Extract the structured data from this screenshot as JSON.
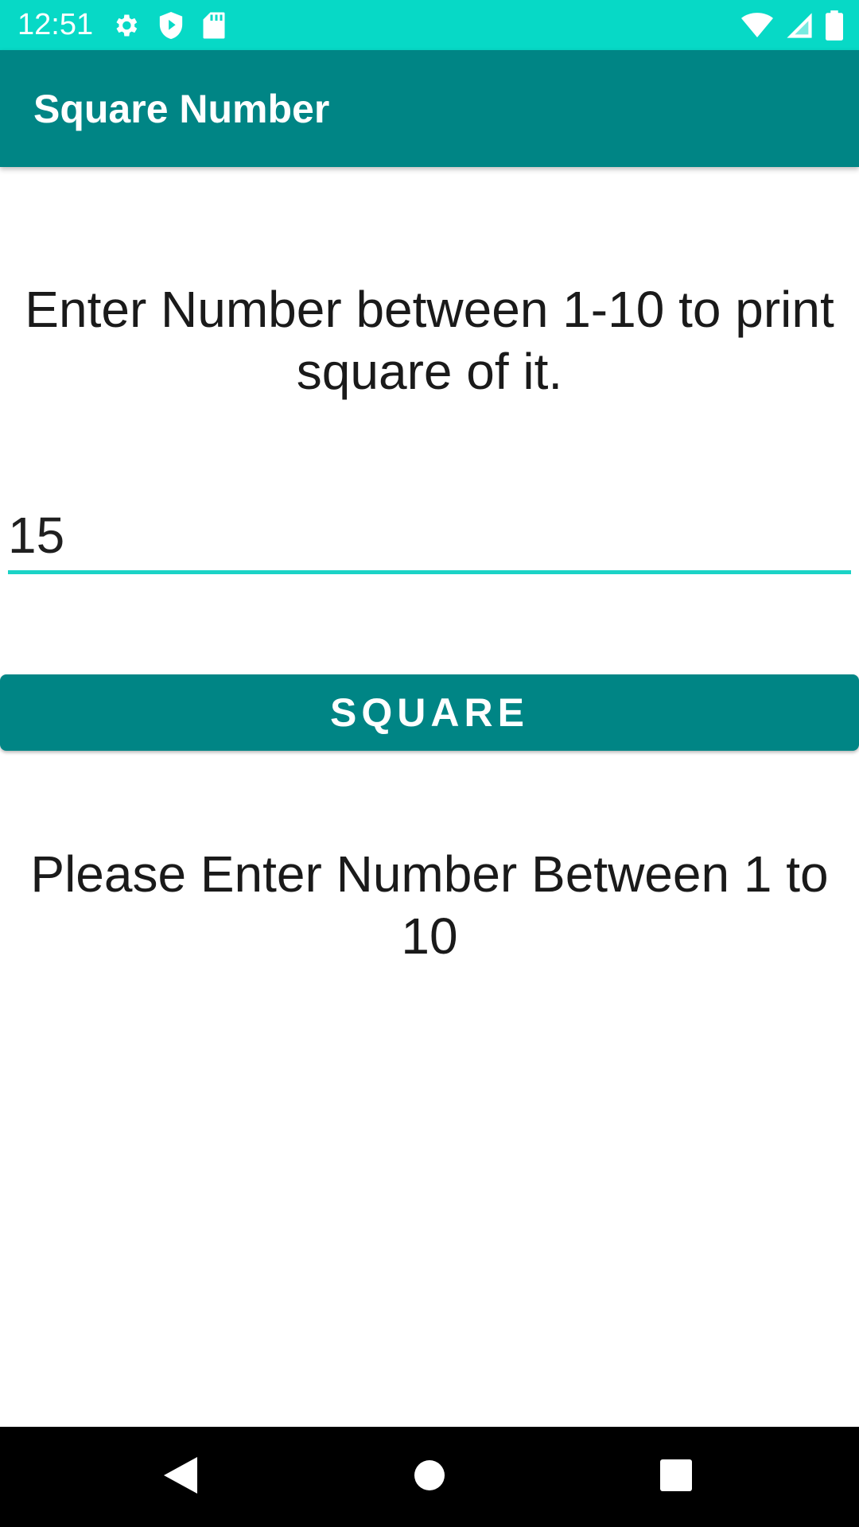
{
  "status_bar": {
    "time": "12:51",
    "left_icons": [
      "settings-icon",
      "shield-icon",
      "sd-card-icon"
    ],
    "right_icons": [
      "wifi-icon",
      "cell-signal-icon",
      "battery-icon"
    ],
    "color": "#07d9c6"
  },
  "app_bar": {
    "title": "Square Number",
    "color": "#008585"
  },
  "main": {
    "instruction_line1": "Enter Number between 1-10 to print",
    "instruction_line2": "square of it.",
    "input_value": "15",
    "button_label": "SQUARE",
    "result_line1": "Please Enter Number Between 1 to",
    "result_line2": "10"
  },
  "nav_bar": {
    "buttons": [
      "back-icon",
      "home-icon",
      "recents-icon"
    ]
  }
}
